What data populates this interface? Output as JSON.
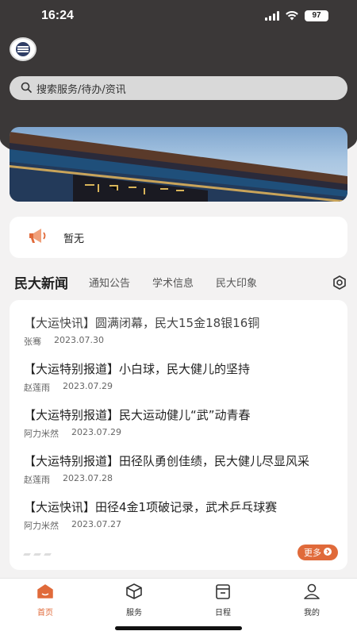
{
  "status_bar": {
    "time": "16:24",
    "battery": "97"
  },
  "search": {
    "placeholder": "搜索服务/待办/资讯",
    "icon": "search-icon"
  },
  "banner": {
    "image": "university-gate-photo"
  },
  "notice": {
    "icon": "megaphone-icon",
    "text": "暂无"
  },
  "tabs": {
    "active": "民大新闻",
    "items": [
      "通知公告",
      "学术信息",
      "民大印象"
    ],
    "settings_icon": "settings-icon"
  },
  "news": [
    {
      "title": "【大运快讯】圆满闭幕，民大15金18银16铜",
      "author": "张骞",
      "date": "2023.07.30"
    },
    {
      "title": "【大运特别报道】小白球，民大健儿的坚持",
      "author": "赵莲雨",
      "date": "2023.07.29"
    },
    {
      "title": "【大运特别报道】民大运动健儿“武”动青春",
      "author": "阿力米然",
      "date": "2023.07.29"
    },
    {
      "title": "【大运特别报道】田径队勇创佳绩，民大健儿尽显风采",
      "author": "赵莲雨",
      "date": "2023.07.28"
    },
    {
      "title": "【大运快讯】田径4金1项破记录，武术乒乓球赛",
      "author": "阿力米然",
      "date": "2023.07.27"
    }
  ],
  "more_label": "更多",
  "tabbar": [
    {
      "label": "首页",
      "icon": "home-icon",
      "active": true
    },
    {
      "label": "服务",
      "icon": "cube-icon",
      "active": false
    },
    {
      "label": "日程",
      "icon": "calendar-icon",
      "active": false
    },
    {
      "label": "我的",
      "icon": "user-icon",
      "active": false
    }
  ],
  "colors": {
    "accent": "#e06a3a",
    "header_bg": "#3b3838"
  }
}
